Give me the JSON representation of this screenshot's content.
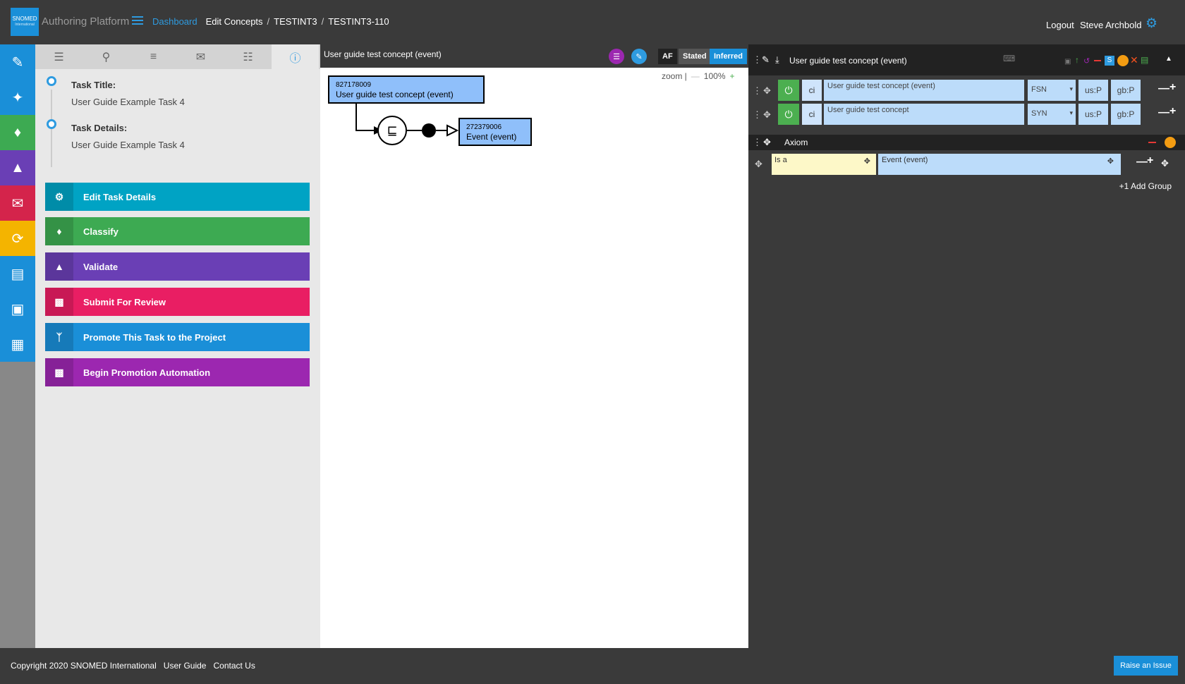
{
  "header": {
    "logo_text": "SNOMED",
    "logo_subtext": "International",
    "app_title": "Authoring Platform",
    "breadcrumbs": [
      "Dashboard",
      "Edit Concepts",
      "TESTINT3",
      "TESTINT3-110"
    ],
    "logout": "Logout",
    "username": "Steve Archbold"
  },
  "rail": {
    "items": [
      {
        "icon": "edit-icon",
        "color": "#1a8fd8"
      },
      {
        "icon": "wand-icon",
        "color": "#1a8fd8"
      },
      {
        "icon": "bell-icon",
        "color": "#3daa52"
      },
      {
        "icon": "graduation-cap-icon",
        "color": "#6a3fb5"
      },
      {
        "icon": "envelope-icon",
        "color": "#d4244b"
      },
      {
        "icon": "sync-icon",
        "color": "#f4b400"
      },
      {
        "icon": "monitor-icon",
        "color": "#1a8fd8"
      },
      {
        "icon": "window-icon",
        "color": "#1a8fd8"
      },
      {
        "icon": "grid-icon",
        "color": "#1a8fd8"
      }
    ]
  },
  "task": {
    "tabs": [
      "list-icon",
      "search-icon",
      "numbered-list-icon",
      "envelope-icon",
      "excel-icon",
      "info-icon"
    ],
    "title_label": "Task Title:",
    "title_value": "User Guide Example Task 4",
    "details_label": "Task Details:",
    "details_value": "User Guide Example Task 4",
    "actions": [
      {
        "label": "Edit Task Details",
        "icon": "gear-icon",
        "color": "#00a3c4"
      },
      {
        "label": "Classify",
        "icon": "bell-icon",
        "color": "#3daa52"
      },
      {
        "label": "Validate",
        "icon": "graduation-cap-icon",
        "color": "#6a3fb5"
      },
      {
        "label": "Submit For Review",
        "icon": "comments-icon",
        "color": "#e91e63"
      },
      {
        "label": "Promote This Task to the Project",
        "icon": "merge-icon",
        "color": "#1a8fd8"
      },
      {
        "label": "Begin Promotion Automation",
        "icon": "archive-icon",
        "color": "#9c27b0"
      }
    ]
  },
  "diagram": {
    "title": "User guide test concept (event)",
    "af": "AF",
    "stated": "Stated",
    "inferred": "Inferred",
    "zoom_label": "zoom |",
    "zoom_value": "100%",
    "concept": {
      "id": "827178009",
      "name": "User guide test concept (event)"
    },
    "parent": {
      "id": "272379006",
      "name": "Event (event)"
    }
  },
  "editor": {
    "title": "User guide test concept (event)",
    "descriptions": [
      {
        "case": "ci",
        "term": "User guide test concept (event)",
        "type": "FSN",
        "us": "us:P",
        "gb": "gb:P"
      },
      {
        "case": "ci",
        "term": "User guide test concept",
        "type": "SYN",
        "us": "us:P",
        "gb": "gb:P"
      }
    ],
    "axiom_label": "Axiom",
    "relationship": {
      "type": "Is a",
      "target": "Event (event)"
    },
    "add_group": "+1 Add Group"
  },
  "footer": {
    "copyright": "Copyright 2020 SNOMED International",
    "user_guide": "User Guide",
    "contact": "Contact Us",
    "raise_issue": "Raise an Issue"
  }
}
